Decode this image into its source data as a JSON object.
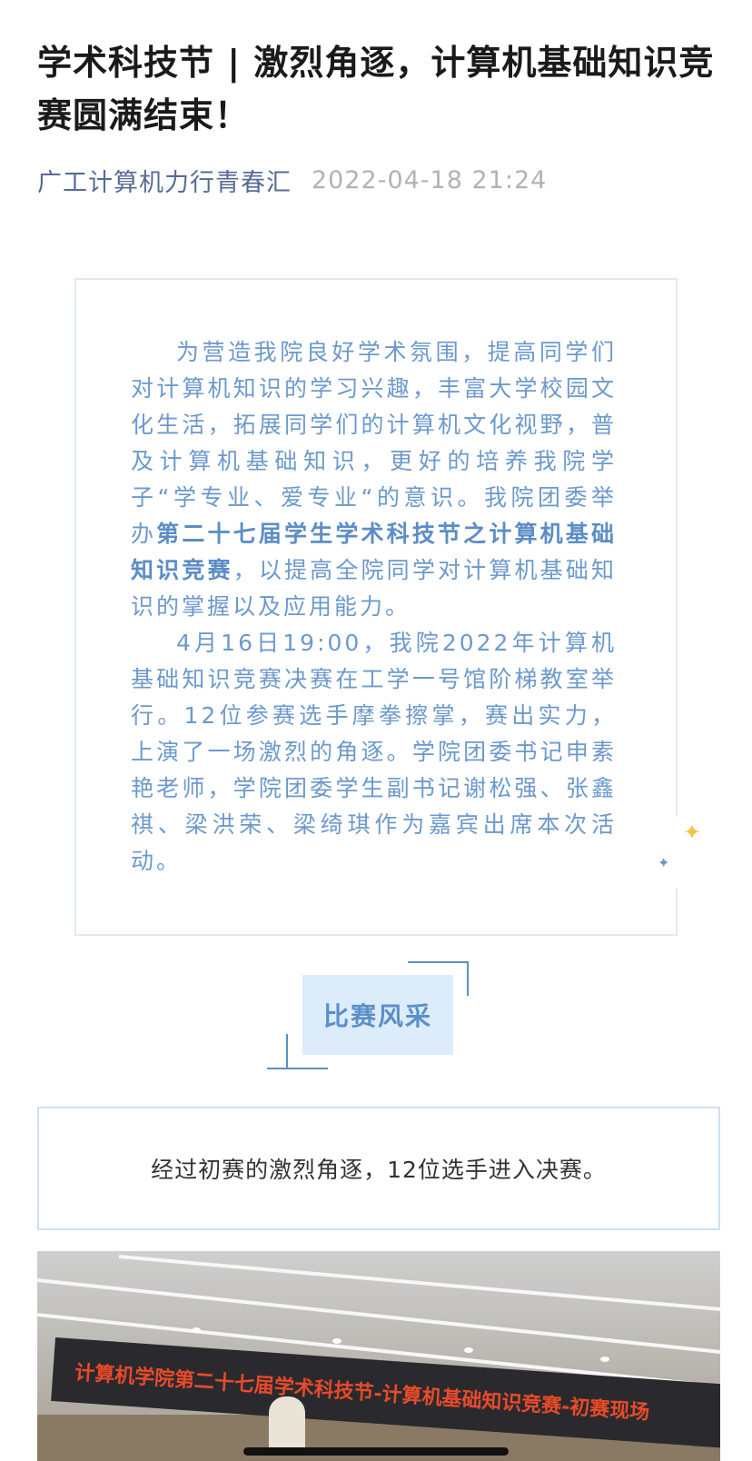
{
  "article": {
    "title": "学术科技节 | 激烈角逐，计算机基础知识竞赛圆满结束！",
    "account": "广工计算机力行青春汇",
    "date": "2022-04-18 21:24"
  },
  "intro": {
    "p1_pre": "为营造我院良好学术氛围，提高同学们对计算机知识的学习兴趣，丰富大学校园文化生活，拓展同学们的计算机文化视野，普及计算机基础知识，更好的培养我院学子“学专业、爱专业“的意识。我院团委举办",
    "p1_bold": "第二十七届学生学术科技节之计算机基础知识竞赛",
    "p1_post": "，以提高全院同学对计算机基础知识的掌握以及应用能力。",
    "p2": "4月16日19:00，我院2022年计算机基础知识竞赛决赛在工学一号馆阶梯教室举行。12位参赛选手摩拳擦掌，赛出实力，上演了一场激烈的角逐。学院团委书记申素艳老师，学院团委学生副书记谢松强、张鑫祺、梁洪荣、梁绮琪作为嘉宾出席本次活动。"
  },
  "section": {
    "label": "比赛风采"
  },
  "info": {
    "text": "经过初赛的激烈角逐，12位选手进入决赛。"
  },
  "photo": {
    "banner_text": "计算机学院第二十七届学术科技节-计算机基础知识竞赛-初赛现场"
  },
  "colors": {
    "title": "#1a1a1a",
    "account": "#576b95",
    "date": "#b2b2b2",
    "accent_blue": "#5b8fc9",
    "label_bg": "#ddecfa",
    "sparkle_gold": "#f3c24a"
  },
  "icons": {
    "sparkle_large": "sparkle-icon",
    "sparkle_small": "sparkle-icon"
  }
}
